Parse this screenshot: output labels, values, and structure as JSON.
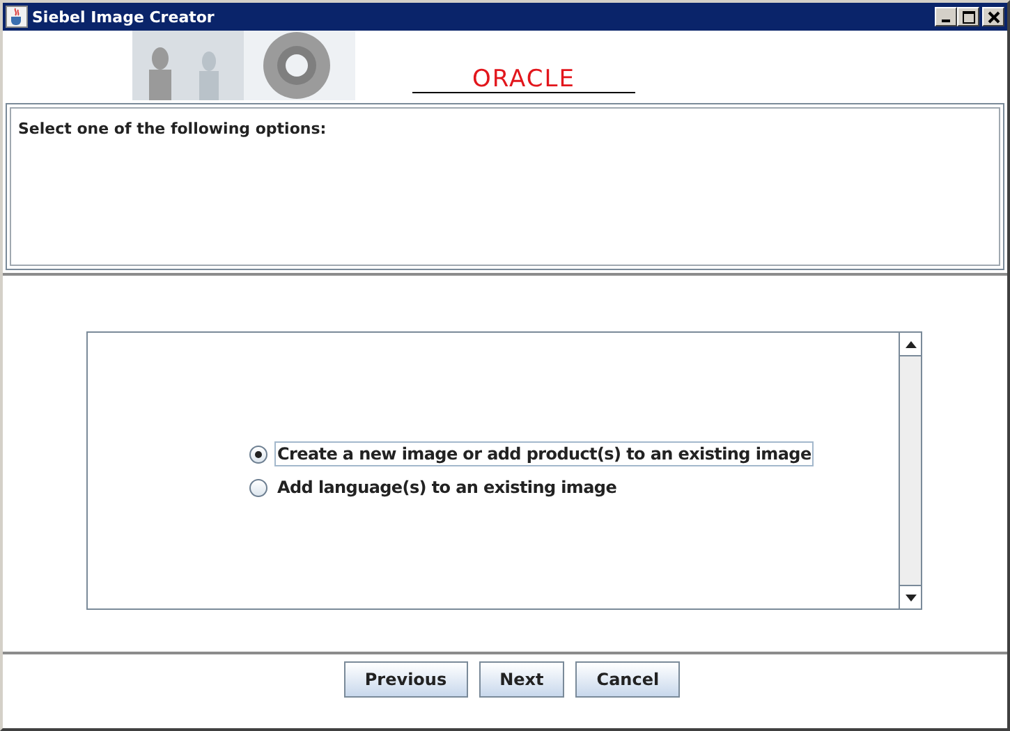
{
  "window": {
    "title": "Siebel Image Creator"
  },
  "banner": {
    "logo": "ORACLE"
  },
  "instructions": {
    "text": "Select one of the following options:"
  },
  "options": [
    {
      "label": "Create a new image or add product(s) to an existing image",
      "selected": true
    },
    {
      "label": "Add language(s) to an existing image",
      "selected": false
    }
  ],
  "buttons": [
    {
      "label": "Previous"
    },
    {
      "label": "Next"
    },
    {
      "label": "Cancel"
    }
  ]
}
